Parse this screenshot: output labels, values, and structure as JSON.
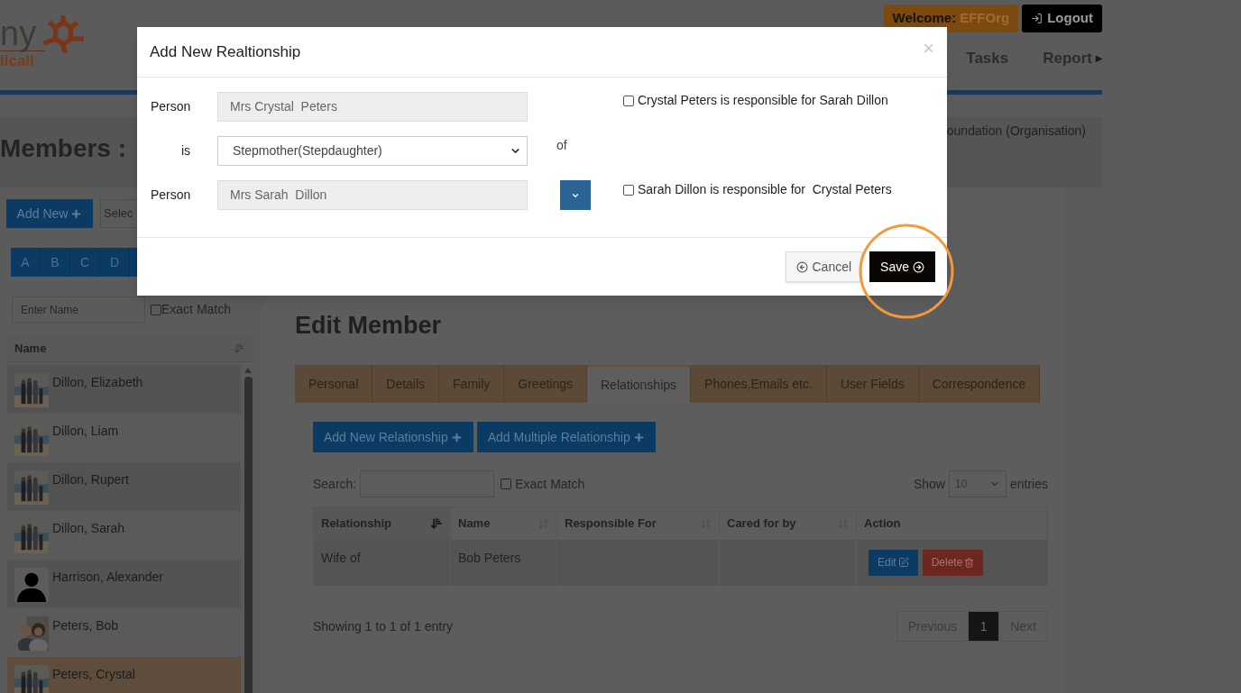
{
  "header": {
    "logo_top": "ny",
    "logo_bottom": "llcall",
    "welcome_label": "Welcome:",
    "welcome_user": "EFFOrg",
    "logout": "Logout",
    "nav": [
      {
        "label": "Tasks",
        "kind": "link"
      },
      {
        "label": "Report",
        "kind": "menu",
        "caret": "▸"
      }
    ]
  },
  "page": {
    "title": "Members :",
    "organisation": "oundation",
    "organisation_type": "(Organisation)"
  },
  "sidebar": {
    "add_new": "Add New",
    "select": "Selec",
    "letters": [
      "A",
      "B",
      "C",
      "D"
    ],
    "name_placeholder": "Enter Name",
    "exact_match": {
      "label": "Exact Match",
      "checked": false
    },
    "column": "Name",
    "members": [
      {
        "name": "Dillon, Elizabeth",
        "selected": false
      },
      {
        "name": "Dillon, Liam",
        "selected": false
      },
      {
        "name": "Dillon, Rupert",
        "selected": false
      },
      {
        "name": "Dillon, Sarah",
        "selected": false
      },
      {
        "name": "Harrison, Alexander",
        "kind": "silhouette",
        "selected": false
      },
      {
        "name": "Peters, Bob",
        "selected": false
      },
      {
        "name": "Peters, Crystal",
        "selected": true
      }
    ]
  },
  "editor": {
    "title": "Edit Member",
    "tabs": [
      {
        "label": "Personal",
        "selected": false
      },
      {
        "label": "Details",
        "selected": false
      },
      {
        "label": "Family",
        "selected": false
      },
      {
        "label": "Greetings",
        "selected": false
      },
      {
        "label": "Relationships",
        "selected": true
      },
      {
        "label": "Phones,Emails etc.",
        "selected": false
      },
      {
        "label": "User Fields",
        "selected": false
      },
      {
        "label": "Correspondence",
        "selected": false
      }
    ],
    "buttons": [
      "Add New Relationship",
      "Add Multiple Relationship"
    ],
    "search_label": "Search:",
    "exact_match": {
      "label": "Exact Match",
      "checked": false
    },
    "show_label": "Show",
    "show_value": "10",
    "entries_label": "entries",
    "columns": [
      {
        "label": "Relationship",
        "sortable": true,
        "sorted": true
      },
      {
        "label": "Name",
        "sortable": true,
        "sorted": false
      },
      {
        "label": "Responsible For",
        "sortable": true,
        "sorted": false
      },
      {
        "label": "Cared for by",
        "sortable": true,
        "sorted": false
      },
      {
        "label": "Action",
        "sortable": false
      }
    ],
    "rows": [
      {
        "relationship": "Wife of",
        "name": "Bob Peters",
        "edit": "Edit",
        "delete": "Delete"
      }
    ],
    "info": "Showing 1 to 1 of 1 entry",
    "pagination": {
      "previous": "Previous",
      "pages": [
        {
          "label": "1",
          "selected": true
        }
      ],
      "next": "Next"
    }
  },
  "dialog": {
    "title": "Add New Realtionship",
    "close": "×",
    "person_1": {
      "label": "Person",
      "value": "Mrs Crystal  Peters"
    },
    "relation": {
      "label": "is",
      "value": "Stepmother(Stepdaughter)"
    },
    "of_label": "of",
    "person_2": {
      "label": "Person",
      "value": "Mrs Sarah  Dillon"
    },
    "checkboxes": [
      {
        "label": "Crystal Peters is responsible for Sarah Dillon",
        "checked": false
      },
      {
        "label": "Sarah Dillon is responsible for  Crystal Peters",
        "checked": false
      }
    ],
    "cancel": "Cancel",
    "save": "Save"
  }
}
